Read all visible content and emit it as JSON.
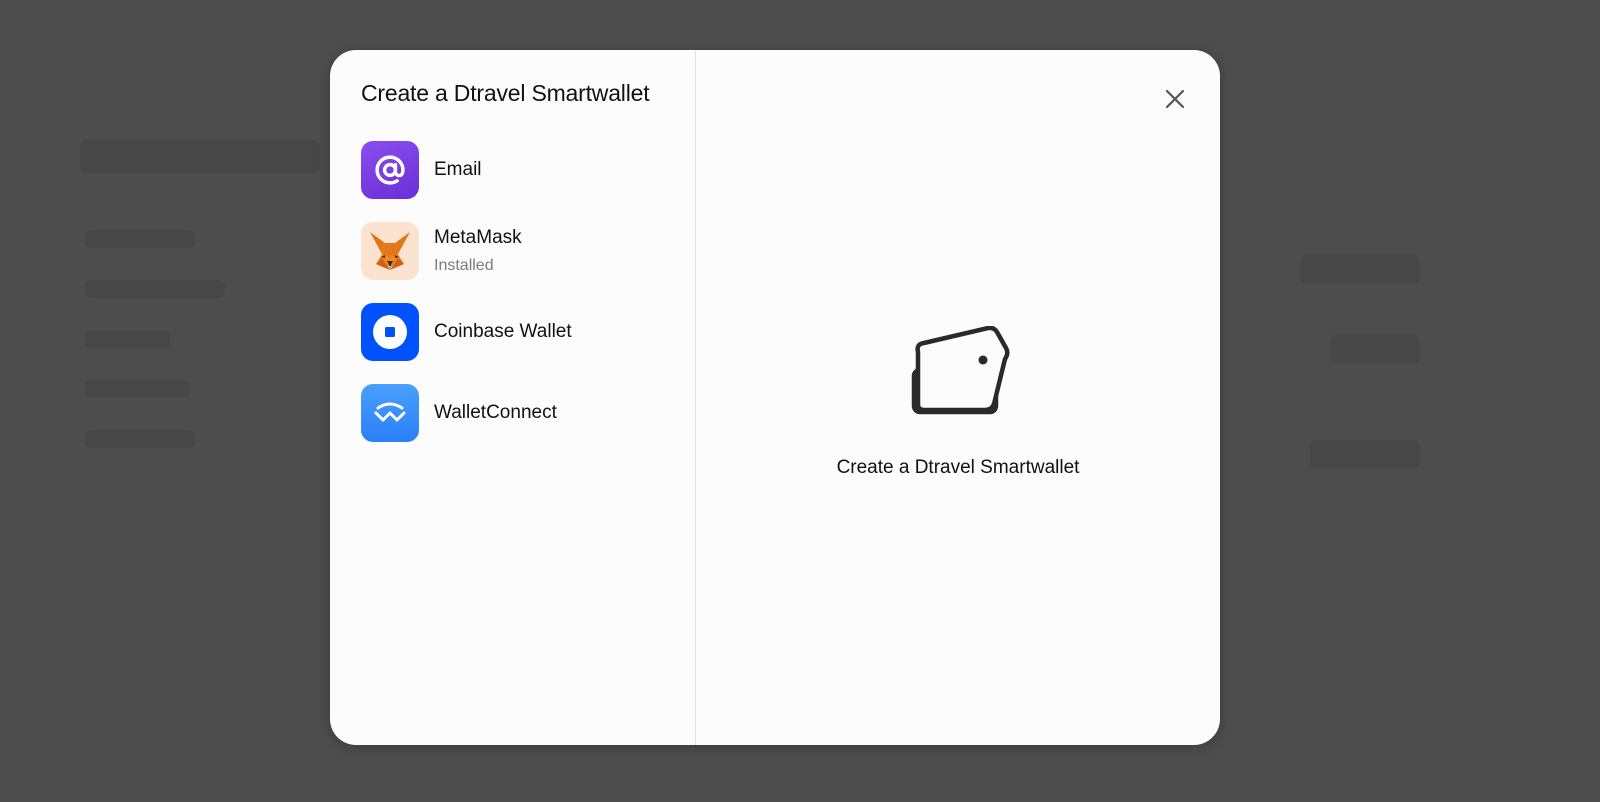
{
  "modal": {
    "title": "Create a Dtravel Smartwallet",
    "wallets": [
      {
        "name": "Email",
        "icon": "at-sign-icon",
        "color": "#7B3FE4"
      },
      {
        "name": "MetaMask",
        "status": "Installed",
        "icon": "metamask-fox-icon",
        "color": "#FBE3CF"
      },
      {
        "name": "Coinbase Wallet",
        "icon": "coinbase-icon",
        "color": "#0052FF"
      },
      {
        "name": "WalletConnect",
        "icon": "walletconnect-icon",
        "color": "#3B99FC"
      }
    ],
    "close_icon": "close-icon",
    "hero": {
      "icon": "wallet-tag-icon",
      "title": "Create a Dtravel Smartwallet"
    }
  }
}
